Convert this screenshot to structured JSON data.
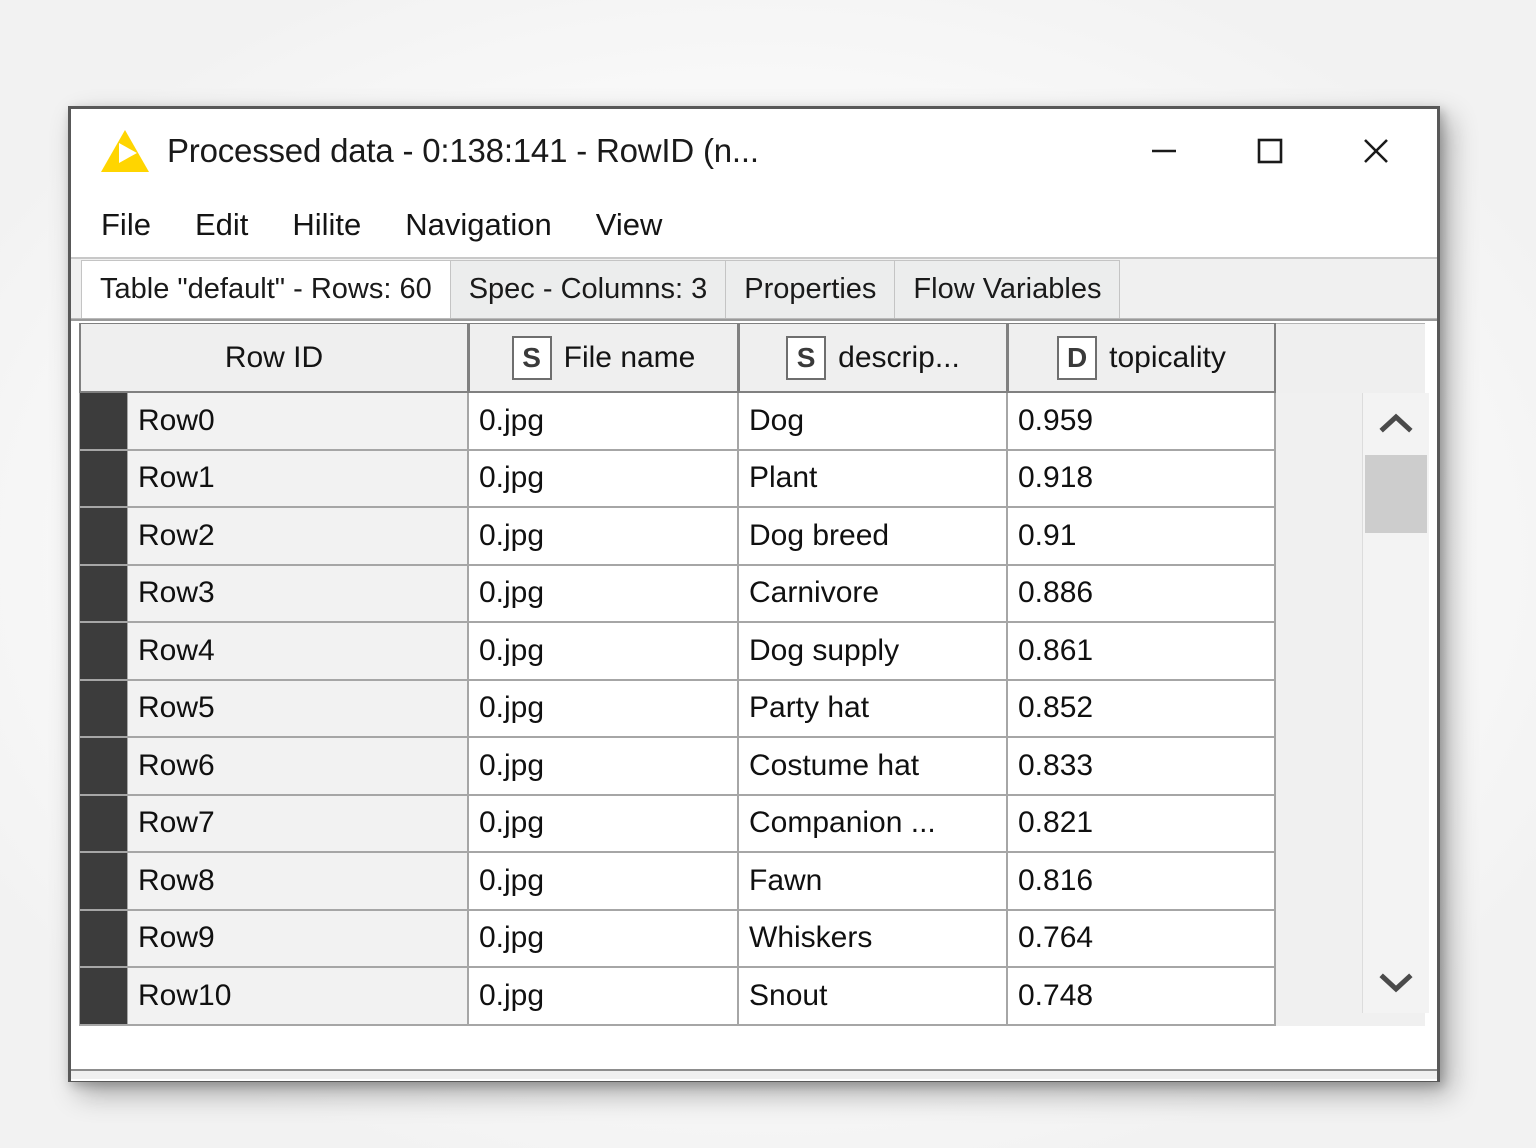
{
  "window": {
    "title": "Processed data - 0:138:141 - RowID (n...",
    "app_icon": "knime-triangle-icon",
    "minimize_label": "minimize-icon",
    "maximize_label": "maximize-icon",
    "close_label": "close-icon"
  },
  "menu": {
    "items": [
      {
        "label": "File"
      },
      {
        "label": "Edit"
      },
      {
        "label": "Hilite"
      },
      {
        "label": "Navigation"
      },
      {
        "label": "View"
      }
    ]
  },
  "tabs": [
    {
      "label": "Table \"default\" - Rows: 60",
      "active": true
    },
    {
      "label": "Spec - Columns: 3",
      "active": false
    },
    {
      "label": "Properties",
      "active": false
    },
    {
      "label": "Flow Variables",
      "active": false
    }
  ],
  "table": {
    "columns": [
      {
        "label": "Row ID",
        "type_badge": ""
      },
      {
        "label": "File name",
        "type_badge": "S"
      },
      {
        "label": "descrip...",
        "type_badge": "S"
      },
      {
        "label": "topicality",
        "type_badge": "D"
      }
    ],
    "rows": [
      {
        "row_id": "Row0",
        "file_name": "0.jpg",
        "description": "Dog",
        "topicality": "0.959"
      },
      {
        "row_id": "Row1",
        "file_name": "0.jpg",
        "description": "Plant",
        "topicality": "0.918"
      },
      {
        "row_id": "Row2",
        "file_name": "0.jpg",
        "description": "Dog breed",
        "topicality": "0.91"
      },
      {
        "row_id": "Row3",
        "file_name": "0.jpg",
        "description": "Carnivore",
        "topicality": "0.886"
      },
      {
        "row_id": "Row4",
        "file_name": "0.jpg",
        "description": "Dog supply",
        "topicality": "0.861"
      },
      {
        "row_id": "Row5",
        "file_name": "0.jpg",
        "description": "Party hat",
        "topicality": "0.852"
      },
      {
        "row_id": "Row6",
        "file_name": "0.jpg",
        "description": "Costume hat",
        "topicality": "0.833"
      },
      {
        "row_id": "Row7",
        "file_name": "0.jpg",
        "description": "Companion ...",
        "topicality": "0.821"
      },
      {
        "row_id": "Row8",
        "file_name": "0.jpg",
        "description": "Fawn",
        "topicality": "0.816"
      },
      {
        "row_id": "Row9",
        "file_name": "0.jpg",
        "description": "Whiskers",
        "topicality": "0.764"
      },
      {
        "row_id": "Row10",
        "file_name": "0.jpg",
        "description": "Snout",
        "topicality": "0.748"
      }
    ]
  },
  "scrollbar": {
    "up_icon": "chevron-up-icon",
    "down_icon": "chevron-down-icon"
  },
  "colors": {
    "accent_yellow": "#FFD500",
    "row_marker": "#3c3c3c",
    "grid_line": "#a6a6a6",
    "header_bg": "#efefef"
  }
}
